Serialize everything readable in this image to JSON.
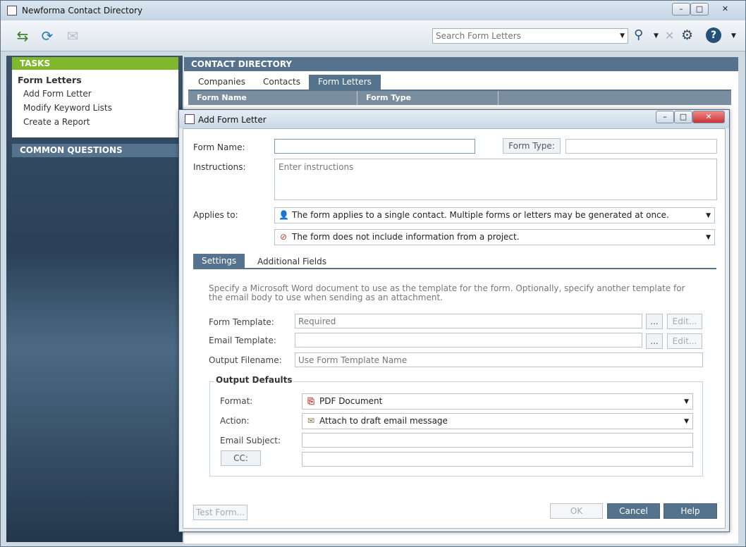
{
  "app": {
    "title": "Newforma Contact Directory",
    "search_placeholder": "Search Form Letters"
  },
  "tasks": {
    "header": "TASKS",
    "section": "Form Letters",
    "links": [
      "Add Form Letter",
      "Modify Keyword Lists",
      "Create a Report"
    ],
    "common_questions": "COMMON QUESTIONS"
  },
  "contact_directory": {
    "header": "CONTACT DIRECTORY",
    "tabs": [
      "Companies",
      "Contacts",
      "Form Letters"
    ],
    "active_tab": "Form Letters",
    "columns": [
      "Form Name",
      "Form Type"
    ]
  },
  "dialog": {
    "title": "Add Form Letter",
    "form_name_label": "Form Name:",
    "form_name_value": "",
    "form_type_button": "Form Type:",
    "form_type_value": "",
    "instructions_label": "Instructions:",
    "instructions_placeholder": "Enter instructions",
    "applies_to_label": "Applies to:",
    "applies_to_contact": "The form applies to a single contact. Multiple forms or letters may be generated at once.",
    "applies_to_project": "The form does not include information from a project.",
    "tabs": [
      "Settings",
      "Additional Fields"
    ],
    "settings_description": "Specify a Microsoft Word document to use as the template for the form. Optionally, specify another template for the email body to use when sending as an attachment.",
    "form_template_label": "Form Template:",
    "form_template_placeholder": "Required",
    "email_template_label": "Email Template:",
    "email_template_placeholder": "",
    "output_filename_label": "Output Filename:",
    "output_filename_placeholder": "Use Form Template Name",
    "browse_label": "...",
    "edit_label": "Edit...",
    "output_defaults": {
      "legend": "Output Defaults",
      "format_label": "Format:",
      "format_value": "PDF Document",
      "action_label": "Action:",
      "action_value": "Attach to draft email message",
      "email_subject_label": "Email Subject:",
      "email_subject_value": "",
      "cc_button": "CC:",
      "cc_value": ""
    },
    "test_form_button": "Test Form...",
    "ok_button": "OK",
    "cancel_button": "Cancel",
    "help_button": "Help"
  }
}
